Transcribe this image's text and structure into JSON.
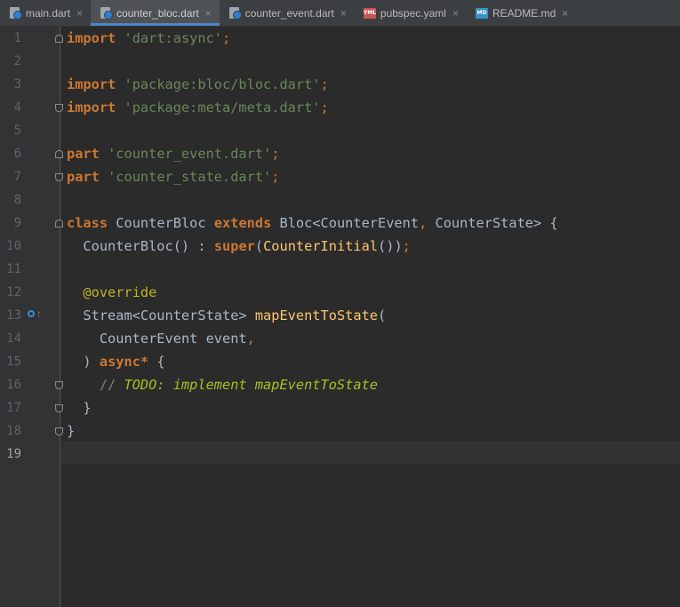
{
  "tabs": [
    {
      "label": "main.dart",
      "icon": "dart-file-icon",
      "active": false
    },
    {
      "label": "counter_bloc.dart",
      "icon": "dart-file-icon",
      "active": true
    },
    {
      "label": "counter_event.dart",
      "icon": "dart-file-icon",
      "active": false
    },
    {
      "label": "pubspec.yaml",
      "icon": "yaml-file-icon",
      "active": false
    },
    {
      "label": "README.md",
      "icon": "markdown-file-icon",
      "active": false
    }
  ],
  "tab_close_glyph": "×",
  "yaml_icon_text": "YML",
  "md_icon_text": "MD",
  "line_numbers": [
    "1",
    "2",
    "3",
    "4",
    "5",
    "6",
    "7",
    "8",
    "9",
    "10",
    "11",
    "12",
    "13",
    "14",
    "15",
    "16",
    "17",
    "18",
    "19"
  ],
  "current_line": "19",
  "code": {
    "l1": {
      "kw": "import",
      "str": "'dart:async'",
      "end": ";"
    },
    "l3": {
      "kw": "import",
      "str": "'package:bloc/bloc.dart'",
      "end": ";"
    },
    "l4": {
      "kw": "import",
      "str": "'package:meta/meta.dart'",
      "end": ";"
    },
    "l6": {
      "kw": "part",
      "str": "'counter_event.dart'",
      "end": ";"
    },
    "l7": {
      "kw": "part",
      "str": "'counter_state.dart'",
      "end": ";"
    },
    "l9": {
      "kw1": "class",
      "name": "CounterBloc",
      "kw2": "extends",
      "base": "Bloc<CounterEvent",
      "comma": ",",
      "base2": "CounterState>",
      "brace": "{"
    },
    "l10": {
      "name": "CounterBloc()",
      "colon": ":",
      "kw": "super",
      "p1": "(",
      "fn": "CounterInitial",
      "p2": "())",
      "end": ";"
    },
    "l12": {
      "at": "@",
      "ann": "override"
    },
    "l13": {
      "type": "Stream<CounterState>",
      "fn": "mapEventToState",
      "p": "("
    },
    "l14": {
      "type": "CounterEvent event",
      "comma": ","
    },
    "l15": {
      "p": ")",
      "kw": "async*",
      "brace": "{"
    },
    "l16": {
      "slashes": "//",
      "todo": "TODO: implement mapEventToState"
    },
    "l17": {
      "brace": "}"
    },
    "l18": {
      "brace": "}"
    }
  },
  "colors": {
    "background": "#2b2b2b",
    "keyword": "#cc7832",
    "string": "#6a8759",
    "function": "#ffc66d",
    "annotation": "#bbb529",
    "todo": "#a8c023",
    "text": "#a9b7c6"
  }
}
